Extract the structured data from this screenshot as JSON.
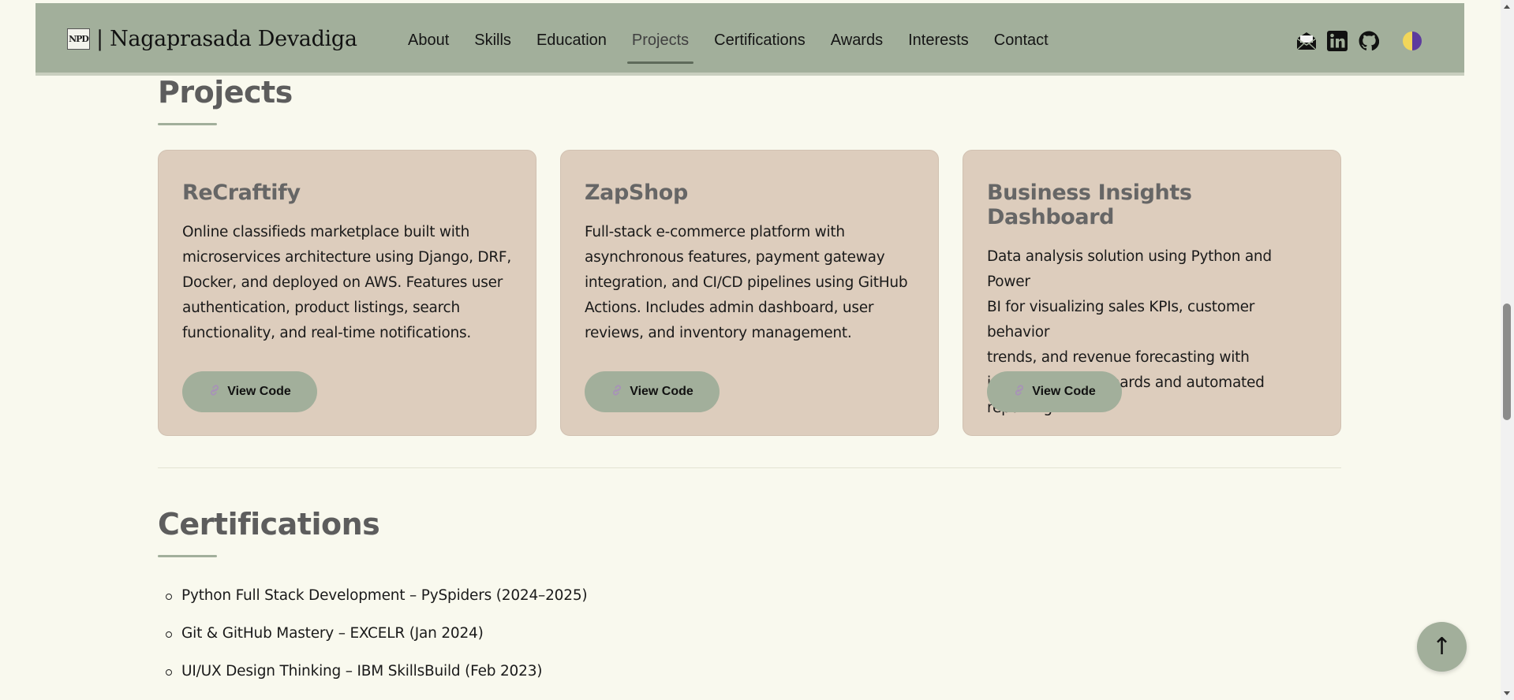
{
  "colors": {
    "navbar": "#a2af9b",
    "page_bg": "#f9f9ee",
    "card_bg": "#ddcdbd",
    "heading": "#5d5d5d",
    "accent": "#a2af9b"
  },
  "brand": {
    "logo_text": "NPD",
    "name": "| Nagaprasada Devadiga"
  },
  "nav": {
    "links": [
      {
        "label": "About"
      },
      {
        "label": "Skills"
      },
      {
        "label": "Education"
      },
      {
        "label": "Projects",
        "active": true
      },
      {
        "label": "Certifications"
      },
      {
        "label": "Awards"
      },
      {
        "label": "Interests"
      },
      {
        "label": "Contact"
      }
    ],
    "icons": [
      "mail-icon",
      "linkedin-icon",
      "github-icon",
      "theme-toggle-icon"
    ]
  },
  "projects": {
    "title": "Projects",
    "items": [
      {
        "title": "ReCraftify",
        "lines": [
          "Online classifieds marketplace built with",
          "microservices architecture using Django, DRF,",
          "Docker, and deployed on AWS. Features user",
          "authentication, product listings, search",
          "functionality, and real-time notifications."
        ],
        "button_label": "View Code",
        "button_icon": "link-icon"
      },
      {
        "title": "ZapShop",
        "lines": [
          "Full-stack e-commerce platform with",
          "asynchronous features, payment gateway",
          "integration, and CI/CD pipelines using GitHub",
          "Actions. Includes admin dashboard, user",
          "reviews, and inventory management."
        ],
        "button_label": "View Code",
        "button_icon": "link-icon"
      },
      {
        "title": "Business Insights Dashboard",
        "lines": [
          "Data analysis solution using Python and Power",
          "BI for visualizing sales KPIs, customer behavior",
          "trends, and revenue forecasting with",
          "interactive dashboards and automated",
          "reporting."
        ],
        "button_label": "View Code",
        "button_icon": "link-icon"
      }
    ]
  },
  "certifications": {
    "title": "Certifications",
    "items": [
      "Python Full Stack Development – PySpiders (2024–2025)",
      "Git & GitHub Mastery – EXCELR (Jan 2024)",
      "UI/UX Design Thinking – IBM SkillsBuild (Feb 2023)"
    ]
  },
  "back_to_top": {
    "label": "↑"
  }
}
